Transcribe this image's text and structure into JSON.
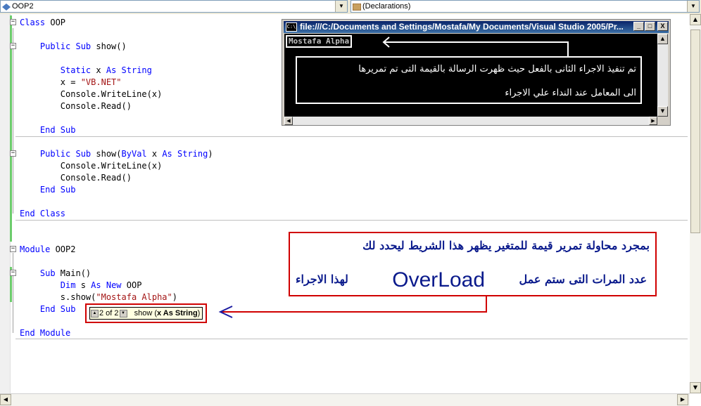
{
  "toolbar": {
    "class_combo": "OOP2",
    "member_combo": "(Declarations)"
  },
  "code": {
    "lines": [
      {
        "tokens": [
          {
            "t": "Class",
            "k": "kw"
          },
          {
            "t": " OOP",
            "k": "id"
          }
        ]
      },
      {
        "tokens": [
          {
            "t": "    Public Sub",
            "k": "kw"
          },
          {
            "t": " show()",
            "k": "id"
          }
        ]
      },
      {
        "tokens": [
          {
            "t": "        Static",
            "k": "kw"
          },
          {
            "t": " x ",
            "k": "id"
          },
          {
            "t": "As String",
            "k": "kw"
          }
        ]
      },
      {
        "tokens": [
          {
            "t": "        x = ",
            "k": "id"
          },
          {
            "t": "\"VB.NET\"",
            "k": "str"
          }
        ]
      },
      {
        "tokens": [
          {
            "t": "        Console.WriteLine(x)",
            "k": "id"
          }
        ]
      },
      {
        "tokens": [
          {
            "t": "        Console.Read()",
            "k": "id"
          }
        ]
      },
      {
        "tokens": [
          {
            "t": "    End Sub",
            "k": "kw"
          }
        ]
      },
      {
        "tokens": [
          {
            "t": "    Public Sub",
            "k": "kw"
          },
          {
            "t": " show(",
            "k": "id"
          },
          {
            "t": "ByVal",
            "k": "kw"
          },
          {
            "t": " x ",
            "k": "id"
          },
          {
            "t": "As String",
            "k": "kw"
          },
          {
            "t": ")",
            "k": "id"
          }
        ]
      },
      {
        "tokens": [
          {
            "t": "        Console.WriteLine(x)",
            "k": "id"
          }
        ]
      },
      {
        "tokens": [
          {
            "t": "        Console.Read()",
            "k": "id"
          }
        ]
      },
      {
        "tokens": [
          {
            "t": "    End Sub",
            "k": "kw"
          }
        ]
      },
      {
        "tokens": [
          {
            "t": "End Class",
            "k": "kw"
          }
        ]
      },
      {
        "tokens": [
          {
            "t": "Module",
            "k": "kw"
          },
          {
            "t": " OOP2",
            "k": "id"
          }
        ]
      },
      {
        "tokens": [
          {
            "t": "    Sub",
            "k": "kw"
          },
          {
            "t": " Main()",
            "k": "id"
          }
        ]
      },
      {
        "tokens": [
          {
            "t": "        Dim",
            "k": "kw"
          },
          {
            "t": " s ",
            "k": "id"
          },
          {
            "t": "As New",
            "k": "kw"
          },
          {
            "t": " OOP",
            "k": "id"
          }
        ]
      },
      {
        "tokens": [
          {
            "t": "        s.show(",
            "k": "id"
          },
          {
            "t": "\"Mostafa Alpha\"",
            "k": "str"
          },
          {
            "t": ")",
            "k": "id"
          }
        ]
      },
      {
        "tokens": [
          {
            "t": "    End Sub",
            "k": "kw"
          }
        ]
      },
      {
        "tokens": [
          {
            "t": "End Module",
            "k": "kw"
          }
        ]
      }
    ]
  },
  "console": {
    "title": "file:///C:/Documents and Settings/Mostafa/My Documents/Visual Studio 2005/Pr...",
    "icon_text": "C:\\",
    "output": "Mostafa Alpha",
    "minimize": "_",
    "maximize": "□",
    "close": "X"
  },
  "note_console": {
    "line1": "تم تنفيذ الاجراء الثانى بالفعل حيث ظهرت الرسالة بالقيمة التى تم تمريرها",
    "line2": "الى المعامل عند النداء علي الاجراء"
  },
  "note_overload": {
    "line1": "بمجرد محاولة تمرير قيمة للمتغير يظهر هذا الشريط ليحدد لك",
    "line2": "عدد المرات التى ستم عمل",
    "keyword": "OverLoad",
    "line3": "لهذا الاجراء"
  },
  "intellisense": {
    "counter": "2 of 2",
    "signature_name": "show (",
    "signature_param": "x As String",
    "signature_end": ")"
  },
  "colors": {
    "keyword": "#0000ff",
    "string": "#a31515",
    "annotation_box": "#d00000",
    "annotation_text": "#0a1a8c",
    "arrow": "#1a1aa0"
  }
}
